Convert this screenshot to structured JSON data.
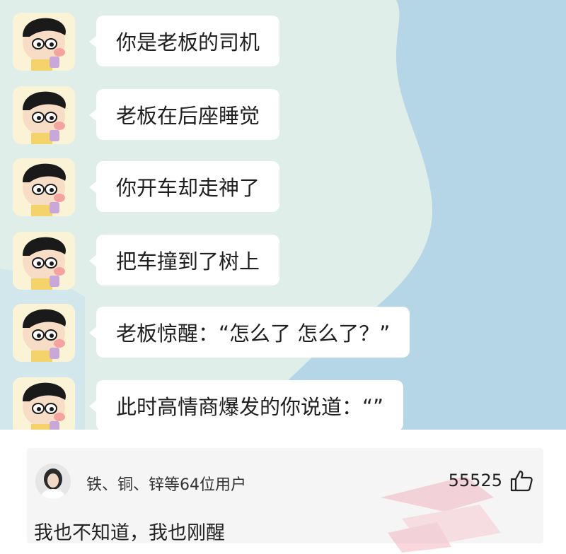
{
  "chat": {
    "messages": [
      {
        "text": "你是老板的司机"
      },
      {
        "text": "老板在后座睡觉"
      },
      {
        "text": "你开车却走神了"
      },
      {
        "text": "把车撞到了树上"
      },
      {
        "text": "老板惊醒：“怎么了 怎么了？”"
      },
      {
        "text": "此时高情商爆发的你说道：“”"
      }
    ],
    "avatar_icon": "crayon-shinchan-avatar-icon"
  },
  "comment": {
    "user_name": "铁、铜、锌等64位用户",
    "like_count": "55525",
    "like_icon": "thumbs-up-icon",
    "text": "我也不知道，我也刚醒"
  },
  "colors": {
    "chat_bg_green": "#dfeee8",
    "chat_bg_blue": "#a9cfe0",
    "bubble": "#ffffff",
    "comment_card": "#f5f5f5"
  }
}
